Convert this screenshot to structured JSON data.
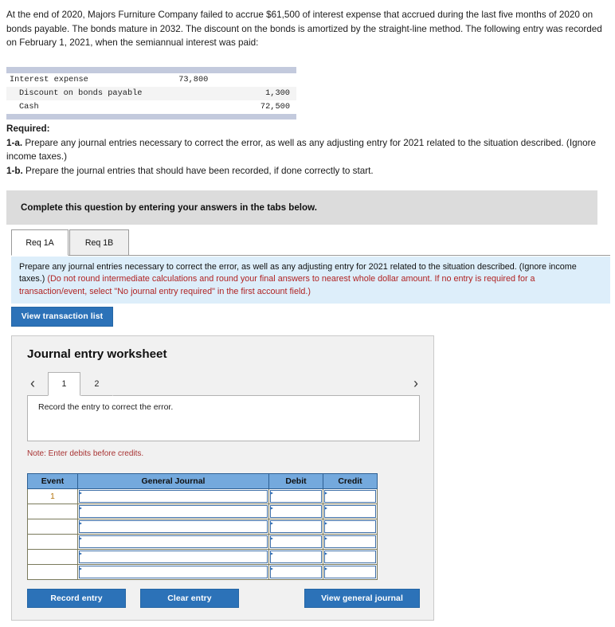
{
  "problem": {
    "text": "At the end of 2020, Majors Furniture Company failed to accrue $61,500 of interest expense that accrued during the last five months of 2020 on bonds payable. The bonds mature in 2032. The discount on the bonds is amortized by the straight-line method. The following entry was recorded on February 1, 2021, when the semiannual interest was paid:"
  },
  "given_entry": {
    "rows": [
      {
        "account": "Interest expense",
        "debit": "73,800",
        "credit": "",
        "indent": 0
      },
      {
        "account": "Discount on bonds payable",
        "debit": "",
        "credit": "1,300",
        "indent": 1
      },
      {
        "account": "Cash",
        "debit": "",
        "credit": "72,500",
        "indent": 1
      }
    ]
  },
  "required": {
    "heading": "Required:",
    "item_a_label": "1-a.",
    "item_a_text": " Prepare any journal entries necessary to correct the error, as well as any adjusting entry for 2021 related to the situation described. (Ignore income taxes.)",
    "item_b_label": "1-b.",
    "item_b_text": " Prepare the journal entries that should have been recorded, if done correctly to start."
  },
  "banner": {
    "text": "Complete this question by entering your answers in the tabs below."
  },
  "tabs": [
    {
      "label": "Req 1A",
      "active": true
    },
    {
      "label": "Req 1B",
      "active": false
    }
  ],
  "instruction": {
    "black_text": "Prepare any journal entries necessary to correct the error, as well as any adjusting entry for 2021 related to the situation described. (Ignore income taxes.) ",
    "red_text": "(Do not round intermediate calculations and round your final answers to nearest whole dollar amount. If no entry is required for a transaction/event, select \"No journal entry required\" in the first account field.)"
  },
  "view_transaction_list_label": "View transaction list",
  "worksheet": {
    "title": "Journal entry worksheet",
    "prev_arrow": "‹",
    "next_arrow": "›",
    "page_tabs": [
      {
        "label": "1",
        "active": true
      },
      {
        "label": "2",
        "active": false
      }
    ],
    "prompt": "Record the entry to correct the error.",
    "note": "Note: Enter debits before credits.",
    "grid": {
      "headers": [
        "Event",
        "General Journal",
        "Debit",
        "Credit"
      ],
      "rows": [
        {
          "event": "1",
          "general_journal": "",
          "debit": "",
          "credit": ""
        },
        {
          "event": "",
          "general_journal": "",
          "debit": "",
          "credit": ""
        },
        {
          "event": "",
          "general_journal": "",
          "debit": "",
          "credit": ""
        },
        {
          "event": "",
          "general_journal": "",
          "debit": "",
          "credit": ""
        },
        {
          "event": "",
          "general_journal": "",
          "debit": "",
          "credit": ""
        },
        {
          "event": "",
          "general_journal": "",
          "debit": "",
          "credit": ""
        }
      ]
    },
    "buttons": {
      "record": "Record entry",
      "clear": "Clear entry",
      "view_general_journal": "View general journal"
    }
  },
  "colors": {
    "accent_blue": "#2c72b8",
    "header_blue": "#74a9dd",
    "instruction_bg": "#ddeefa",
    "banner_gray": "#dcdcdc",
    "note_red": "#a83232",
    "event_orange": "#b5740c"
  }
}
